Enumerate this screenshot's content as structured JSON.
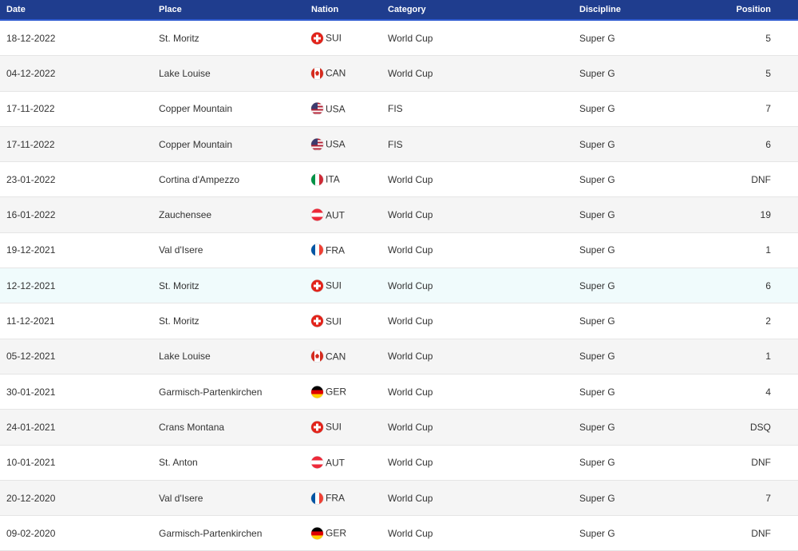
{
  "header": {
    "date": "Date",
    "place": "Place",
    "nation": "Nation",
    "category": "Category",
    "discipline": "Discipline",
    "position": "Position"
  },
  "rows": [
    {
      "date": "18-12-2022",
      "place": "St. Moritz",
      "nation": "SUI",
      "flag": "sui",
      "category": "World Cup",
      "discipline": "Super G",
      "position": "5"
    },
    {
      "date": "04-12-2022",
      "place": "Lake Louise",
      "nation": "CAN",
      "flag": "can",
      "category": "World Cup",
      "discipline": "Super G",
      "position": "5"
    },
    {
      "date": "17-11-2022",
      "place": "Copper Mountain",
      "nation": "USA",
      "flag": "usa",
      "category": "FIS",
      "discipline": "Super G",
      "position": "7"
    },
    {
      "date": "17-11-2022",
      "place": "Copper Mountain",
      "nation": "USA",
      "flag": "usa",
      "category": "FIS",
      "discipline": "Super G",
      "position": "6"
    },
    {
      "date": "23-01-2022",
      "place": "Cortina d'Ampezzo",
      "nation": "ITA",
      "flag": "ita",
      "category": "World Cup",
      "discipline": "Super G",
      "position": "DNF"
    },
    {
      "date": "16-01-2022",
      "place": "Zauchensee",
      "nation": "AUT",
      "flag": "aut",
      "category": "World Cup",
      "discipline": "Super G",
      "position": "19"
    },
    {
      "date": "19-12-2021",
      "place": "Val d'Isere",
      "nation": "FRA",
      "flag": "fra",
      "category": "World Cup",
      "discipline": "Super G",
      "position": "1"
    },
    {
      "date": "12-12-2021",
      "place": "St. Moritz",
      "nation": "SUI",
      "flag": "sui",
      "category": "World Cup",
      "discipline": "Super G",
      "position": "6"
    },
    {
      "date": "11-12-2021",
      "place": "St. Moritz",
      "nation": "SUI",
      "flag": "sui",
      "category": "World Cup",
      "discipline": "Super G",
      "position": "2"
    },
    {
      "date": "05-12-2021",
      "place": "Lake Louise",
      "nation": "CAN",
      "flag": "can",
      "category": "World Cup",
      "discipline": "Super G",
      "position": "1"
    },
    {
      "date": "30-01-2021",
      "place": "Garmisch-Partenkirchen",
      "nation": "GER",
      "flag": "ger",
      "category": "World Cup",
      "discipline": "Super G",
      "position": "4"
    },
    {
      "date": "24-01-2021",
      "place": "Crans Montana",
      "nation": "SUI",
      "flag": "sui",
      "category": "World Cup",
      "discipline": "Super G",
      "position": "DSQ"
    },
    {
      "date": "10-01-2021",
      "place": "St. Anton",
      "nation": "AUT",
      "flag": "aut",
      "category": "World Cup",
      "discipline": "Super G",
      "position": "DNF"
    },
    {
      "date": "20-12-2020",
      "place": "Val d'Isere",
      "nation": "FRA",
      "flag": "fra",
      "category": "World Cup",
      "discipline": "Super G",
      "position": "7"
    },
    {
      "date": "09-02-2020",
      "place": "Garmisch-Partenkirchen",
      "nation": "GER",
      "flag": "ger",
      "category": "World Cup",
      "discipline": "Super G",
      "position": "DNF"
    }
  ],
  "highlighted_row": 8,
  "colors": {
    "header_bg": "#1f3d8e",
    "header_border": "#2f5bd1",
    "row_alt": "#f5f5f5",
    "row_highlight": "#f0fbfc"
  }
}
